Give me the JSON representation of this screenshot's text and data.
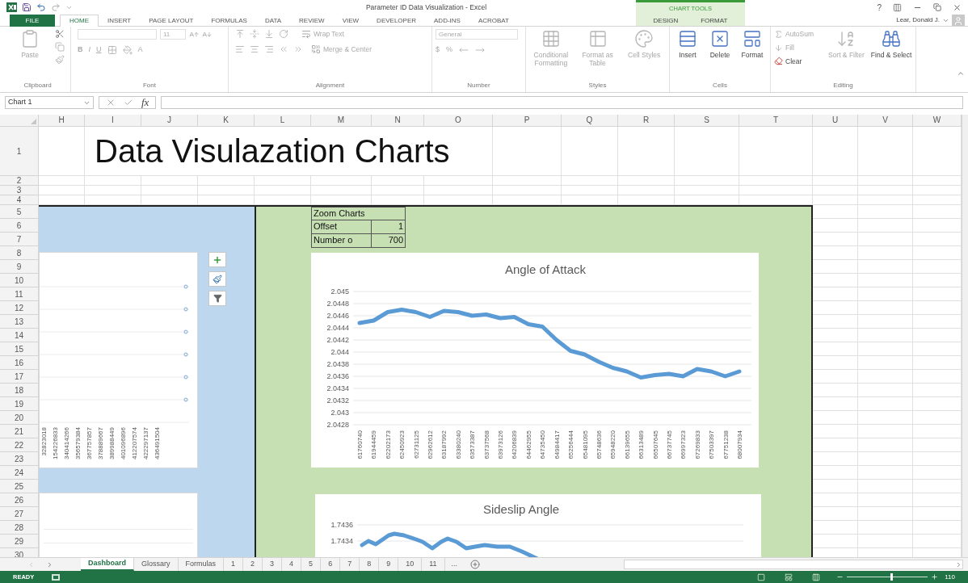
{
  "window": {
    "title": "Parameter ID Data Visualization - Excel",
    "context_group": "CHART TOOLS",
    "help": "?",
    "user": "Lear, Donald J."
  },
  "ribbon_tabs": [
    {
      "label": "FILE",
      "kind": "file",
      "selected": false
    },
    {
      "label": "HOME",
      "kind": "tab",
      "selected": true
    },
    {
      "label": "INSERT",
      "kind": "tab",
      "selected": false
    },
    {
      "label": "PAGE LAYOUT",
      "kind": "tab",
      "selected": false
    },
    {
      "label": "FORMULAS",
      "kind": "tab",
      "selected": false
    },
    {
      "label": "DATA",
      "kind": "tab",
      "selected": false
    },
    {
      "label": "REVIEW",
      "kind": "tab",
      "selected": false
    },
    {
      "label": "VIEW",
      "kind": "tab",
      "selected": false
    },
    {
      "label": "DEVELOPER",
      "kind": "tab",
      "selected": false
    },
    {
      "label": "ADD-INS",
      "kind": "tab",
      "selected": false
    },
    {
      "label": "ACROBAT",
      "kind": "tab",
      "selected": false
    },
    {
      "label": "DESIGN",
      "kind": "context",
      "selected": false
    },
    {
      "label": "FORMAT",
      "kind": "context",
      "selected": false
    }
  ],
  "ribbon": {
    "clipboard": {
      "label": "Clipboard",
      "paste": "Paste"
    },
    "font": {
      "label": "Font",
      "size": "11",
      "bold": "B",
      "italic": "I",
      "underline": "U",
      "font_color": "A"
    },
    "alignment": {
      "label": "Alignment",
      "wrap_text": "Wrap Text",
      "merge": "Merge & Center"
    },
    "number": {
      "label": "Number",
      "format": "General",
      "currency": "$",
      "percent": "%"
    },
    "styles": {
      "label": "Styles",
      "items": [
        {
          "label": "Conditional Formatting",
          "disabled": true
        },
        {
          "label": "Format as Table",
          "disabled": true
        },
        {
          "label": "Cell Styles",
          "disabled": true
        }
      ]
    },
    "cells": {
      "label": "Cells",
      "items": [
        {
          "label": "Insert",
          "disabled": false
        },
        {
          "label": "Delete",
          "disabled": false
        },
        {
          "label": "Format",
          "disabled": false
        }
      ]
    },
    "editing": {
      "label": "Editing",
      "small": [
        {
          "label": "AutoSum",
          "disabled": true
        },
        {
          "label": "Fill",
          "disabled": true
        },
        {
          "label": "Clear",
          "disabled": false
        }
      ],
      "large": [
        {
          "label": "Sort & Filter",
          "disabled": true
        },
        {
          "label": "Find & Select",
          "disabled": false
        }
      ]
    }
  },
  "formula_bar": {
    "name_box": "Chart 1",
    "fx": "fx"
  },
  "columns": [
    "H",
    "I",
    "J",
    "K",
    "L",
    "M",
    "N",
    "O",
    "P",
    "Q",
    "R",
    "S",
    "T",
    "U",
    "V",
    "W"
  ],
  "rows": [
    "1",
    "2",
    "3",
    "4",
    "5",
    "6",
    "7",
    "8",
    "9",
    "10",
    "11",
    "12",
    "13",
    "14",
    "15",
    "16",
    "17",
    "18",
    "19",
    "20",
    "21",
    "22",
    "23",
    "24",
    "25",
    "26",
    "27",
    "28",
    "29",
    "30"
  ],
  "sheet": {
    "title": "Data Visulazation Charts",
    "zoom_table": {
      "heading": "Zoom Charts",
      "rows": [
        {
          "label": "Offset",
          "value": "1"
        },
        {
          "label": "Number o",
          "value": "700"
        }
      ]
    },
    "left_chart": {
      "x_labels": [
        "32823018",
        "154226833",
        "340414266",
        "356579384",
        "367757857",
        "378889667",
        "389988449",
        "401096896",
        "412207574",
        "422297137",
        "436491504"
      ]
    },
    "angle_chart": {
      "chart_data": {
        "type": "line",
        "title": "Angle of Attack",
        "categories": [
          "61760740",
          "61944459",
          "62202173",
          "62450923",
          "62731125",
          "62962612",
          "63187992",
          "63380240",
          "63573387",
          "63737568",
          "63973126",
          "64206839",
          "64462955",
          "64735450",
          "64984417",
          "65256444",
          "65481095",
          "65748636",
          "65948220",
          "66139655",
          "66313489",
          "66507645",
          "66737745",
          "66997323",
          "67269833",
          "67503397",
          "67751238",
          "68007934"
        ],
        "grid": true,
        "series": [
          {
            "color": "#5b9bd5",
            "values": [
              2.04448,
              2.04452,
              2.04466,
              2.0447,
              2.04466,
              2.04458,
              2.04468,
              2.04466,
              2.0446,
              2.04462,
              2.04456,
              2.04458,
              2.04446,
              2.04442,
              2.0442,
              2.04402,
              2.04396,
              2.04384,
              2.04374,
              2.04368,
              2.04358,
              2.04362,
              2.04364,
              2.0436,
              2.04372,
              2.04368,
              2.0436,
              2.04368
            ]
          }
        ],
        "yticks": [
          {
            "value": 2.045,
            "label": "2.045"
          },
          {
            "value": 2.0448,
            "label": "2.0448"
          },
          {
            "value": 2.0446,
            "label": "2.0446"
          },
          {
            "value": 2.0444,
            "label": "2.0444"
          },
          {
            "value": 2.0442,
            "label": "2.0442"
          },
          {
            "value": 2.044,
            "label": "2.044"
          },
          {
            "value": 2.0438,
            "label": "2.0438"
          },
          {
            "value": 2.0436,
            "label": "2.0436"
          },
          {
            "value": 2.0434,
            "label": "2.0434"
          },
          {
            "value": 2.0432,
            "label": "2.0432"
          },
          {
            "value": 2.043,
            "label": "2.043"
          },
          {
            "value": 2.0428,
            "label": "2.0428"
          }
        ],
        "ylim": [
          2.0428,
          2.045
        ]
      }
    },
    "sideslip_chart": {
      "title": "Sideslip Angle",
      "y_labels": [
        "1.7436",
        "1.7434"
      ]
    }
  },
  "sheet_tabs": [
    {
      "label": "Dashboard",
      "selected": true
    },
    {
      "label": "Glossary",
      "selected": false
    },
    {
      "label": "Formulas",
      "selected": false
    },
    {
      "label": "1",
      "selected": false
    },
    {
      "label": "2",
      "selected": false
    },
    {
      "label": "3",
      "selected": false
    },
    {
      "label": "4",
      "selected": false
    },
    {
      "label": "5",
      "selected": false
    },
    {
      "label": "6",
      "selected": false
    },
    {
      "label": "7",
      "selected": false
    },
    {
      "label": "8",
      "selected": false
    },
    {
      "label": "9",
      "selected": false
    },
    {
      "label": "10",
      "selected": false
    },
    {
      "label": "11",
      "selected": false
    }
  ],
  "more_tabs": "...",
  "status_bar": {
    "mode": "READY",
    "zoom": {
      "level": 0.54
    },
    "zoom_label": "110"
  }
}
